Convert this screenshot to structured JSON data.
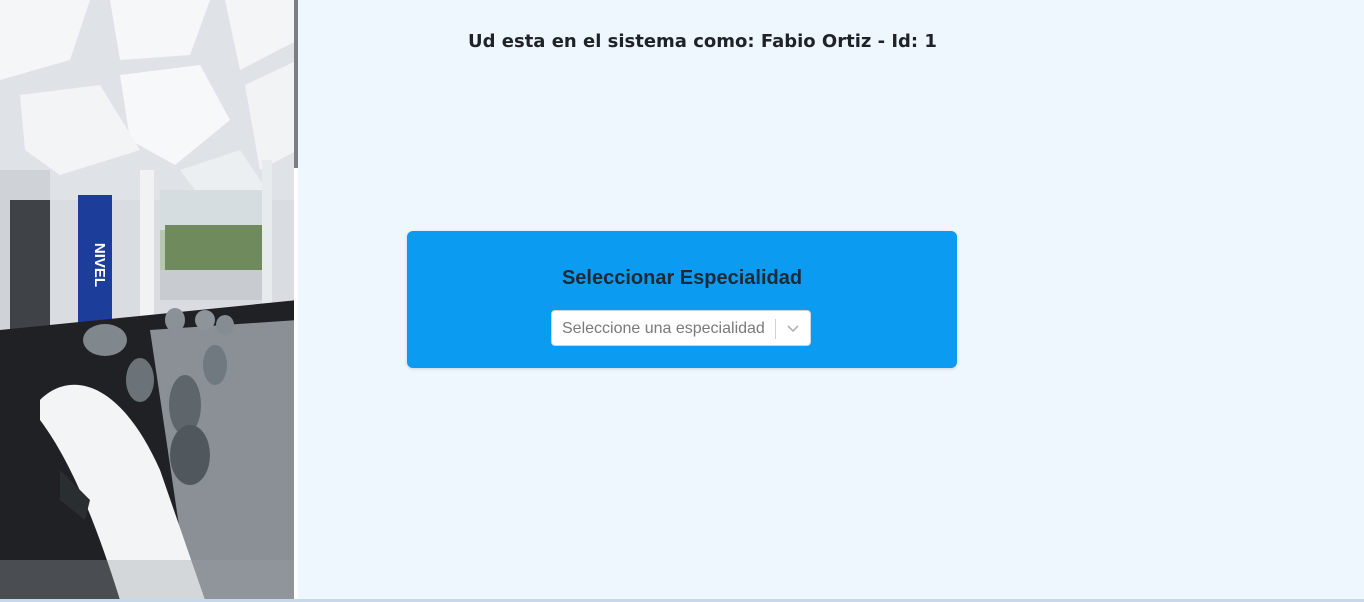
{
  "header": {
    "user_line": "Ud esta en el sistema como: Fabio Ortiz - Id: 1"
  },
  "card": {
    "title": "Seleccionar Especialidad",
    "select": {
      "placeholder": "Seleccione una especialidad",
      "icon": "chevron-down-icon"
    }
  },
  "photo": {
    "sign_text": "NIVEL"
  },
  "colors": {
    "background": "#eef6fe",
    "card": "#0b9bf0",
    "title_text": "#1b2a36"
  }
}
